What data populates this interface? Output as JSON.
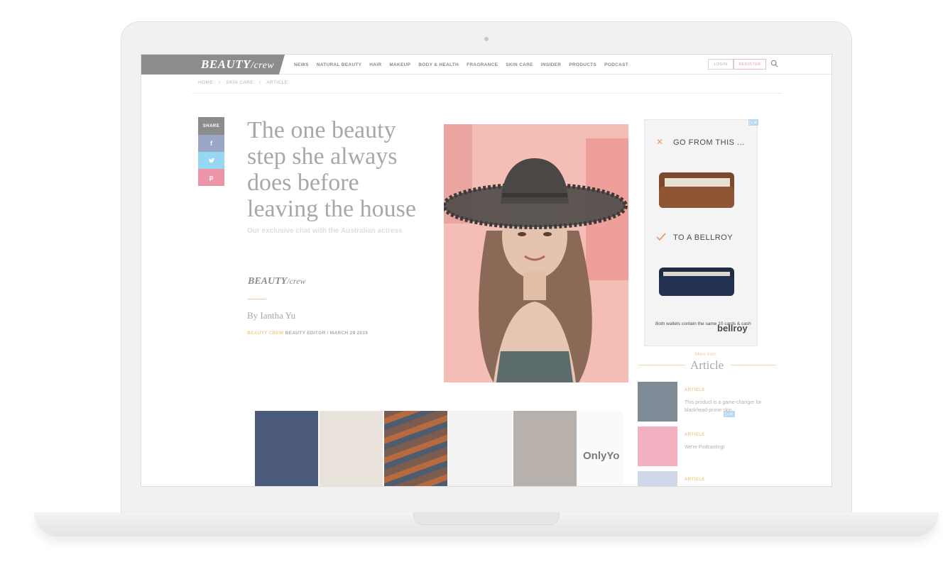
{
  "nav": {
    "logo_main": "BEAUTY",
    "logo_sub": "/crew",
    "links": [
      "NEWS",
      "NATURAL BEAUTY",
      "HAIR",
      "MAKEUP",
      "BODY & HEALTH",
      "FRAGRANCE",
      "SKIN CARE",
      "INSIDER",
      "PRODUCTS",
      "PODCAST"
    ],
    "login": "LOGIN",
    "register": "REGISTER"
  },
  "breadcrumb": [
    "HOME",
    "/",
    "SKIN CARE",
    "/",
    "ARTICLE"
  ],
  "share": {
    "label": "SHARE",
    "facebook": "f",
    "twitter": "t",
    "pinterest": "p"
  },
  "article": {
    "title": "The one beauty step she always does before leaving the house",
    "subtitle": "Our exclusive chat with the Australian actress",
    "byline_logo_main": "BEAUTY",
    "byline_logo_sub": "/crew",
    "author": "By Iantha Yu",
    "meta_source": "BEAUTY CREW",
    "meta_rest": " BEAUTY EDITOR / MARCH 29 2019"
  },
  "ad_right": {
    "line1": "GO FROM THIS ...",
    "line2": "TO A BELLROY",
    "small": "Both wallets contain the same 10 cards & cash",
    "brand": "bellroy"
  },
  "more_from": {
    "small": "More from",
    "title": "Article",
    "items": [
      {
        "category": "ARTICLE",
        "text": "This product is a game-changer for blackhead-prone skin",
        "thumb_color": "#7e8a96"
      },
      {
        "category": "ARTICLE",
        "text": "We're Podcasting!",
        "thumb_color": "#f3b0c0"
      },
      {
        "category": "ARTICLE",
        "text": "",
        "thumb_color": "#cfd8ea"
      }
    ]
  },
  "ad_bottom": {
    "brand": "OnlyYo",
    "tiles": [
      "#4b5a78",
      "#e8e2da",
      "#7c5c4e",
      "#f2f2f2",
      "#b7b0ab"
    ]
  }
}
